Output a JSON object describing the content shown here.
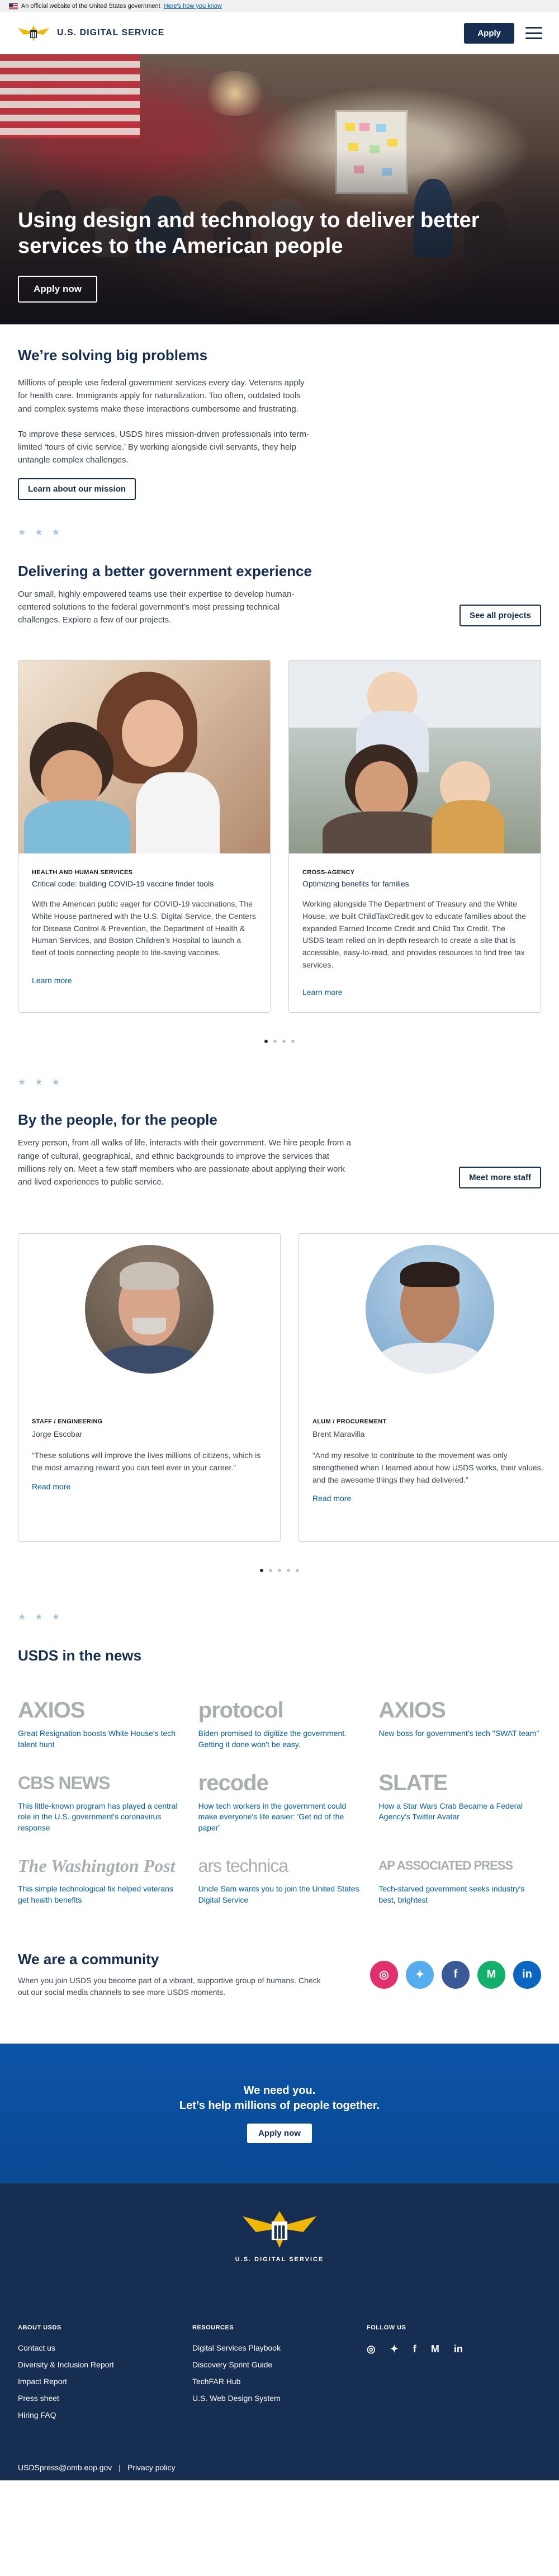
{
  "gov_banner": {
    "text": "An official website of the United States government",
    "link": "Here's how you know"
  },
  "header": {
    "brand": "U.S. DIGITAL SERVICE",
    "apply_label": "Apply"
  },
  "hero": {
    "title": "Using design and technology to deliver better services to the American people",
    "button": "Apply now"
  },
  "problems": {
    "title": "We’re solving big problems",
    "p1": "Millions of people use federal government services every day. Veterans apply for health care. Immigrants apply for naturalization. Too often, outdated tools and complex systems make these interactions cumbersome and frustrating.",
    "p2": "To improve these services, USDS hires mission-driven professionals into term-limited ‘tours of civic service.’ By working alongside civil servants, they help untangle complex challenges.",
    "button": "Learn about our mission"
  },
  "deliver": {
    "title": "Delivering a better government experience",
    "text": "Our small, highly empowered teams use their expertise to develop human-centered solutions to the federal government’s most pressing technical challenges. Explore a few of our projects.",
    "button": "See all projects",
    "cards": [
      {
        "eyebrow": "HEALTH AND HUMAN SERVICES",
        "title": "Critical code: building COVID-19 vaccine finder tools",
        "text": "With the American public eager for COVID-19 vaccinations, The White House partnered with the U.S. Digital Service, the Centers for Disease Control & Prevention, the Department of Health & Human Services, and Boston Children’s Hospital to launch a fleet of tools connecting people to life-saving vaccines.",
        "link": "Learn more"
      },
      {
        "eyebrow": "CROSS-AGENCY",
        "title": "Optimizing benefits for families",
        "text": "Working alongside The Department of Treasury and the White House, we built ChildTaxCredit.gov to educate families about the expanded Earned Income Credit and Child Tax Credit. The USDS team relied on in-depth research to create a site that is accessible, easy-to-read, and provides resources to find free tax services.",
        "link": "Learn more"
      }
    ]
  },
  "people": {
    "title": "By the people, for the people",
    "text": "Every person, from all walks of life, interacts with their government. We hire people from a range of cultural, geographical, and ethnic backgrounds to improve the services that millions rely on. Meet a few staff members who are passionate about applying their work and lived experiences to public service.",
    "button": "Meet more staff",
    "cards": [
      {
        "eyebrow": "STAFF / ENGINEERING",
        "name": "Jorge Escobar",
        "quote": "“These solutions will improve the lives millions of citizens, which is the most amazing reward you can feel ever in your career.”",
        "link": "Read more"
      },
      {
        "eyebrow": "ALUM / PROCUREMENT",
        "name": "Brent Maravilla",
        "quote": "“And my resolve to contribute to the movement was only strengthened when I learned about how USDS works, their values, and the awesome things they had delivered.”",
        "link": "Read more"
      }
    ]
  },
  "news": {
    "title": "USDS in the news",
    "items": [
      {
        "logo": "AXIOS",
        "text": "Great Resignation boosts White House's tech talent hunt"
      },
      {
        "logo": "protocol",
        "text": "Biden promised to digitize the government. Getting it done won't be easy."
      },
      {
        "logo": "AXIOS",
        "text": "New boss for government's tech \"SWAT team\""
      },
      {
        "logo": "CBS NEWS",
        "text": "This little-known program has played a central role in the U.S. government's coronavirus response"
      },
      {
        "logo": "recode",
        "text": "How tech workers in the government could make everyone's life easier: 'Get rid of the paper'"
      },
      {
        "logo": "SLATE",
        "text": "How a Star Wars Crab Became a Federal Agency's Twitter Avatar"
      },
      {
        "logo": "The Washington Post",
        "text": "This simple technological fix helped veterans get health benefits"
      },
      {
        "logo": "ars technica",
        "text": "Uncle Sam wants you to join the United States Digital Service"
      },
      {
        "logo": "AP ASSOCIATED PRESS",
        "text": "Tech-starved government seeks industry's best, brightest"
      }
    ]
  },
  "community": {
    "title": "We are a community",
    "text": "When you join USDS you become part of a vibrant, supportive group of humans. Check out our social media channels to see more USDS moments."
  },
  "cta": {
    "line1": "We need you.",
    "line2": "Let’s help millions of people together.",
    "button": "Apply now"
  },
  "footer": {
    "brand": "U.S. DIGITAL SERVICE",
    "about_title": "ABOUT USDS",
    "about_links": [
      "Contact us",
      "Diversity & Inclusion Report",
      "Impact Report",
      "Press sheet",
      "Hiring FAQ"
    ],
    "resources_title": "RESOURCES",
    "resources_links": [
      "Digital Services Playbook",
      "Discovery Sprint Guide",
      "TechFAR Hub",
      "U.S. Web Design System"
    ],
    "follow_title": "FOLLOW US",
    "email": "USDSpress@omb.eop.gov",
    "separator": "|",
    "privacy": "Privacy policy"
  },
  "colors": {
    "navy": "#162e51",
    "link": "#005ea2",
    "cta_blue": "#0c53a6",
    "instagram": "#e1306c",
    "twitter": "#55acee",
    "facebook": "#3b5998",
    "medium": "#12b06b",
    "linkedin": "#0a66c2"
  },
  "icons": [
    "flag-icon",
    "usds-eagle-logo",
    "menu-icon",
    "star-icon",
    "instagram-icon",
    "twitter-icon",
    "facebook-icon",
    "medium-icon",
    "linkedin-icon"
  ]
}
